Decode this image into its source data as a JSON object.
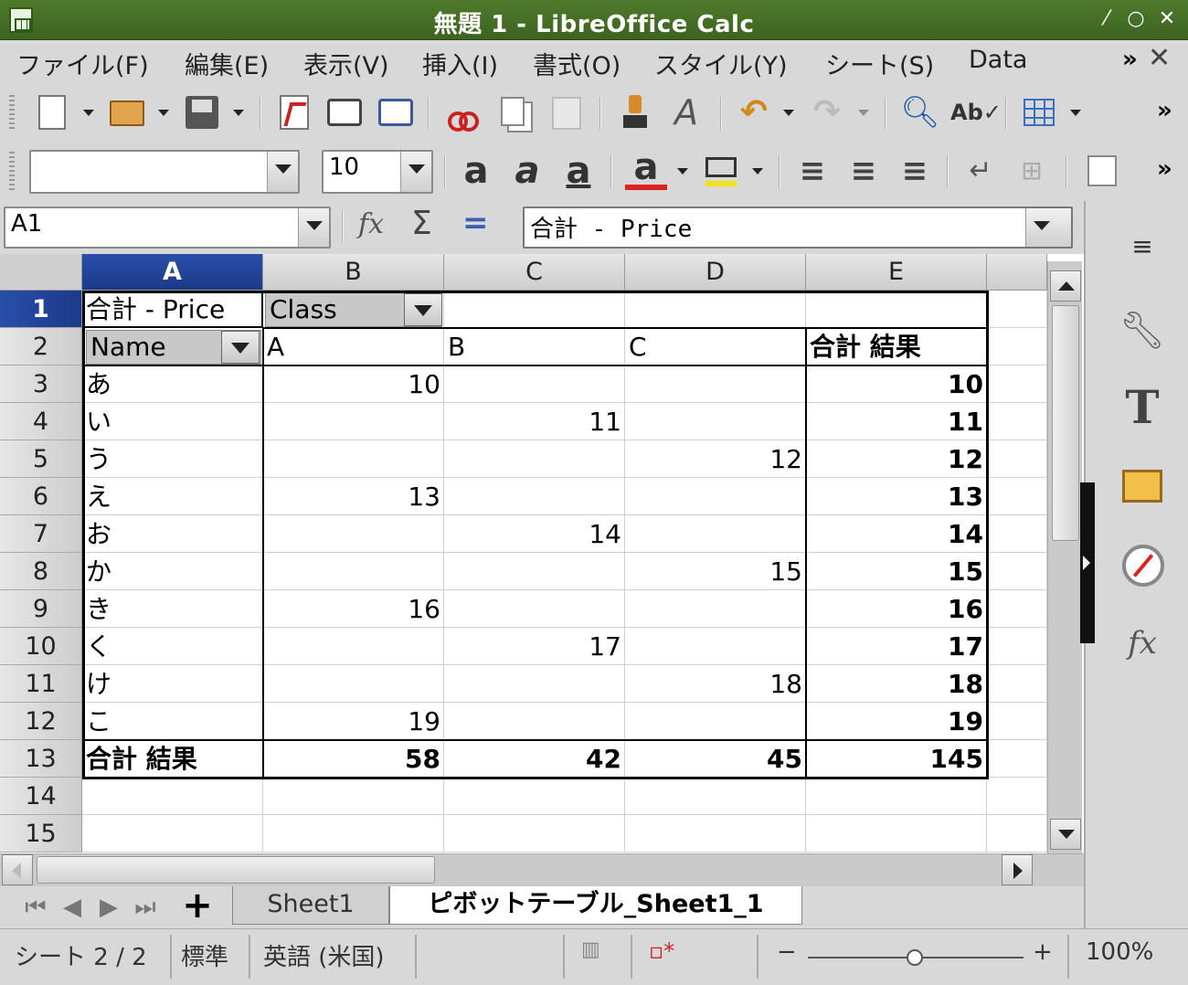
{
  "window": {
    "title": "無題 1 - LibreOffice Calc",
    "buttons": [
      "⁄",
      "○",
      "✕"
    ]
  },
  "menu": {
    "items": [
      "ファイル(F)",
      "編集(E)",
      "表示(V)",
      "挿入(I)",
      "書式(O)",
      "スタイル(Y)",
      "シート(S)",
      "Data"
    ],
    "overflow": "»",
    "close": "✕"
  },
  "toolbar_more": "»",
  "formatting": {
    "font_name": "",
    "font_size": "10"
  },
  "formula_bar": {
    "name_box": "A1",
    "content": "合計 - Price",
    "sum_icon": "Σ",
    "equals_icon": "="
  },
  "columns": [
    "A",
    "B",
    "C",
    "D",
    "E"
  ],
  "rows": [
    "1",
    "2",
    "3",
    "4",
    "5",
    "6",
    "7",
    "8",
    "9",
    "10",
    "11",
    "12",
    "13",
    "14",
    "15"
  ],
  "pivot": {
    "data_field": "合計 - Price",
    "column_field": "Class",
    "row_field": "Name",
    "col_headers": [
      "A",
      "B",
      "C",
      "合計 結果"
    ],
    "rows": [
      {
        "name": "あ",
        "A": "10",
        "B": "",
        "C": "",
        "total": "10"
      },
      {
        "name": "い",
        "A": "",
        "B": "11",
        "C": "",
        "total": "11"
      },
      {
        "name": "う",
        "A": "",
        "B": "",
        "C": "12",
        "total": "12"
      },
      {
        "name": "え",
        "A": "13",
        "B": "",
        "C": "",
        "total": "13"
      },
      {
        "name": "お",
        "A": "",
        "B": "14",
        "C": "",
        "total": "14"
      },
      {
        "name": "か",
        "A": "",
        "B": "",
        "C": "15",
        "total": "15"
      },
      {
        "name": "き",
        "A": "16",
        "B": "",
        "C": "",
        "total": "16"
      },
      {
        "name": "く",
        "A": "",
        "B": "17",
        "C": "",
        "total": "17"
      },
      {
        "name": "け",
        "A": "",
        "B": "",
        "C": "18",
        "total": "18"
      },
      {
        "name": "こ",
        "A": "19",
        "B": "",
        "C": "",
        "total": "19"
      }
    ],
    "grand_total_label": "合計 結果",
    "grand_totals": {
      "A": "58",
      "B": "42",
      "C": "45",
      "total": "145"
    }
  },
  "sheet_tabs": {
    "tabs": [
      "Sheet1",
      "ピボットテーブル_Sheet1_1"
    ],
    "active_index": 1,
    "add": "+"
  },
  "status_bar": {
    "sheet": "シート 2 / 2",
    "style": "標準",
    "language": "英語 (米国)",
    "zoom": "100%",
    "zoom_minus": "−",
    "zoom_plus": "+",
    "zoom_level": 0.5
  },
  "icons": {
    "sidebar": [
      "properties-icon",
      "wrench-icon",
      "styles-icon",
      "gallery-icon",
      "navigator-icon",
      "functions-icon"
    ]
  }
}
